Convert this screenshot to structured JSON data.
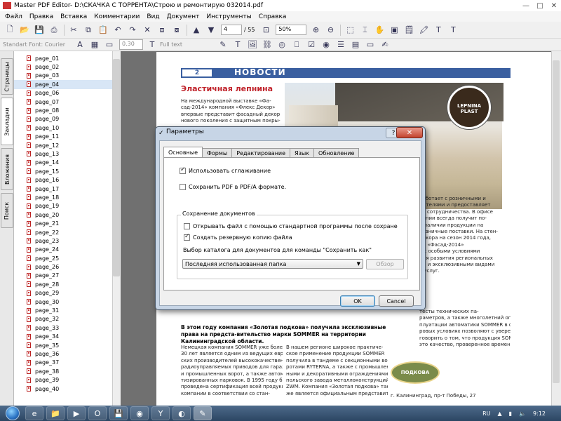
{
  "window": {
    "title": "Master PDF Editor- D:\\СКАЧКА С ТОРРЕНТА\\Строю и ремонтирую 032014.pdf",
    "controls": [
      "—",
      "□",
      "✕"
    ]
  },
  "menu": [
    "Файл",
    "Правка",
    "Вставка",
    "Комментарии",
    "Вид",
    "Документ",
    "Инструменты",
    "Справка"
  ],
  "toolbar": {
    "page_input": "4",
    "page_total": "/ 55",
    "zoom": "50%"
  },
  "toolbar2": {
    "font_label": "Standart Font: Courier",
    "line_width": "0.30",
    "fill_mode": "Full text"
  },
  "sidetabs": [
    "Страницы",
    "Закладки",
    "Вложения",
    "Поиск"
  ],
  "bookmarks": [
    "page_01",
    "page_02",
    "page_03",
    "page_04",
    "page_06",
    "page_07",
    "page_08",
    "page_09",
    "page_10",
    "page_11",
    "page_12",
    "page_13",
    "page_14",
    "page_15",
    "page_16",
    "page_17",
    "page_18",
    "page_19",
    "page_20",
    "page_21",
    "page_22",
    "page_23",
    "page_24",
    "page_25",
    "page_26",
    "page_27",
    "page_28",
    "page_29",
    "page_30",
    "page_31",
    "page_32",
    "page_33",
    "page_34",
    "page_35",
    "page_36",
    "page_37",
    "page_38",
    "page_39",
    "page_40"
  ],
  "selected_bookmark": "page_04",
  "document": {
    "news_number": "2",
    "news_title": "НОВОСТИ",
    "article_title": "Эластичная лепнина",
    "article_lines": [
      "На международной выставке «Фа-",
      "сад-2014» компания «Флекс Декор»",
      "впервые представит фасадный декор",
      "нового поколения с защитным покры-"
    ],
    "logo_text": "LEPNINA PLAST",
    "right_col": [
      "работает с розничными и",
      "мателями и предоставляет",
      "ия сотрудничества. В офисе",
      "пании всегда получит по-",
      "о наличии продукции на",
      "розничные поставки. На стен-",
      "декора на сезон 2014 года,",
      "ии «Фасад-2014»",
      "я с особыми условиями",
      "для развития региональных",
      "ом и эксклюзивными видами",
      "х услуг."
    ],
    "right_bottom": [
      "тесты технических па-",
      "раметров, а также многолетний опыт экс-",
      "плуатации автоматики SOMMER в самых су-",
      "ровых условиях позволяют с уверенностью",
      "говорить о том, что продукция SOMMER –",
      "это качество, проверенное временем."
    ],
    "lower_head": "В этом году компания «Золотая подкова» получила эксклюзивные права на предста-вительство марки SOMMER на территории Калининградской области.",
    "col1": [
      "Немецкая компания SOMMER уже более",
      "30 лет является одним из ведущих европей-",
      "ских производителей высококачественных",
      "радиоуправляемых приводов для гаражных",
      "и промышленных ворот, а также автома-",
      "тизированных парковок. В 1995 году была",
      "проведена сертификация всей продукции",
      "компании в соответствии со стан-"
    ],
    "col2": [
      "В нашем регионе широкое практиче-",
      "ское применение продукции SOMMER",
      "получила в тандеме с секционными во-",
      "ротами RYTERNA, а также с промышлен-",
      "ными и декоративными ограждениями",
      "польского завода металлоконструкций",
      "ZWM. Компания «Золотая подкова» так-",
      "же является официальным представите-"
    ],
    "podkova_label": "ПОДКОВА",
    "address": "г. Калининград, пр-т Победы, 27"
  },
  "dialog": {
    "title": "Параметры",
    "help": "?",
    "close": "✕",
    "tabs": [
      "Основные",
      "Формы",
      "Редактирование",
      "Язык",
      "Обновление"
    ],
    "active_tab": "Основные",
    "opt_smoothing": "Использовать сглаживание",
    "opt_pdfa": "Сохранить PDF  в PDF/A формате.",
    "group_title": "Сохранение документов",
    "opt_open_std": "Открывать файл с помощью стандартной программы после сохране",
    "opt_backup": "Создать резервную копию файла",
    "dir_label": "Выбор каталога для документов для команды \"Сохранить как\"",
    "dir_select": "Последняя использованная папка",
    "browse": "Обзор",
    "ok": "OK",
    "cancel": "Cancel"
  },
  "taskbar": {
    "lang": "RU",
    "time": "9:12"
  },
  "colors": {
    "accent_blue": "#3a5fa0",
    "headline_red": "#c0232b",
    "dialog_frame": "#c7d5e6"
  }
}
